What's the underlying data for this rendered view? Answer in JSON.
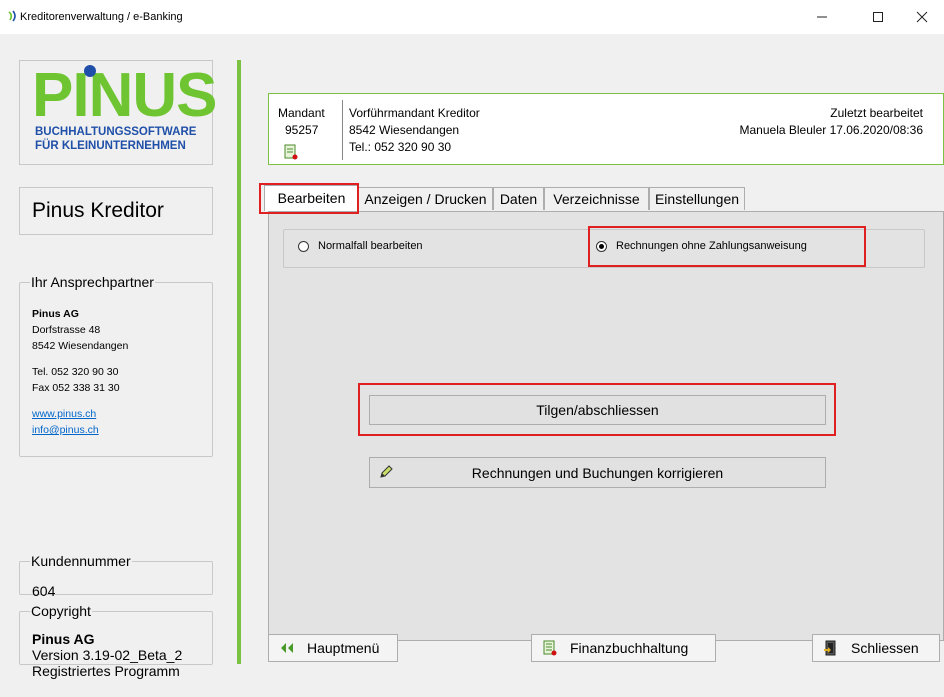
{
  "window": {
    "title": "Kreditorenverwaltung / e-Banking"
  },
  "logo": {
    "name": "PINUS",
    "tagline1": "BUCHHALTUNGSSOFTWARE",
    "tagline2": "FÜR KLEINUNTERNEHMEN"
  },
  "product": {
    "title": "Pinus Kreditor"
  },
  "contact": {
    "legend": "Ihr Ansprechpartner",
    "company": "Pinus AG",
    "street": "Dorfstrasse 48",
    "city": "8542 Wiesendangen",
    "tel": "Tel. 052 320 90 30",
    "fax": "Fax  052 338 31 30",
    "web": "www.pinus.ch",
    "email": "info@pinus.ch"
  },
  "kunden": {
    "legend": "Kundennummer",
    "value": "604"
  },
  "copyright": {
    "legend": "Copyright",
    "company": "Pinus AG",
    "version": "Version 3.19-02_Beta_2",
    "status": "Registriertes Programm"
  },
  "header": {
    "mandant_label": "Mandant",
    "mandant_nr": "95257",
    "mandant_name": "Vorführmandant Kreditor",
    "mandant_city": "8542 Wiesendangen",
    "mandant_tel": "Tel.: 052 320 90 30",
    "last_edit_label": "Zuletzt bearbeitet",
    "last_edit_value": "Manuela Bleuler 17.06.2020/08:36"
  },
  "tabs": [
    {
      "label": "Bearbeiten"
    },
    {
      "label": "Anzeigen / Drucken"
    },
    {
      "label": "Daten"
    },
    {
      "label": "Verzeichnisse"
    },
    {
      "label": "Einstellungen"
    }
  ],
  "options": {
    "normal": "Normalfall bearbeiten",
    "ohne": "Rechnungen ohne Zahlungsanweisung",
    "selected": "ohne"
  },
  "actions": {
    "tilgen": "Tilgen/abschliessen",
    "korrigieren": "Rechnungen und Buchungen korrigieren"
  },
  "bottom": {
    "hauptmenu": "Hauptmenü",
    "finanz": "Finanzbuchhaltung",
    "schliessen": "Schliessen"
  },
  "colors": {
    "green": "#7cc242",
    "blue": "#1f4fa8",
    "highlight": "#e02020"
  }
}
